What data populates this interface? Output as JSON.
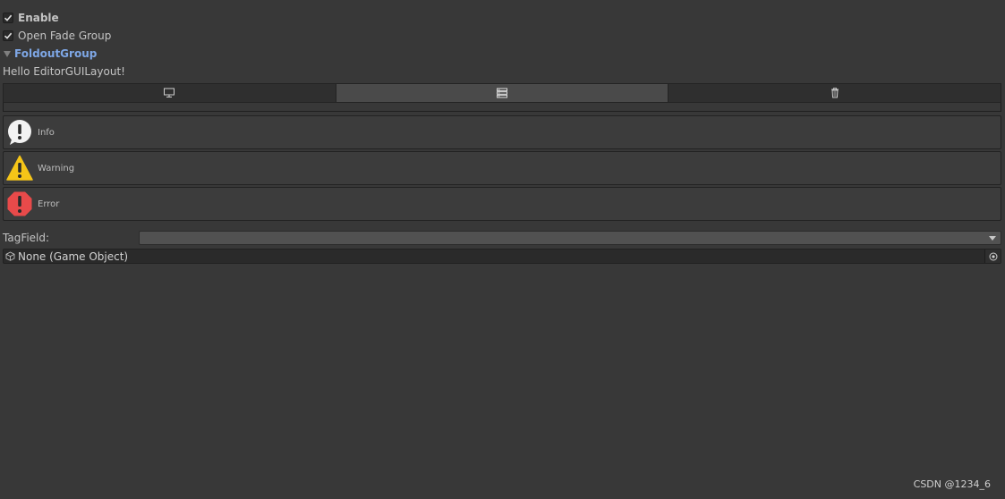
{
  "enable": {
    "label": "Enable",
    "checked": true
  },
  "fade_group": {
    "label": "Open Fade Group",
    "checked": true
  },
  "foldout": {
    "label": "FoldoutGroup",
    "expanded": true
  },
  "hello_label": "Hello EditorGUILayout!",
  "toolbar": {
    "buttons": [
      {
        "icon": "monitor-icon",
        "selected": false
      },
      {
        "icon": "server-icon",
        "selected": true
      },
      {
        "icon": "trash-icon",
        "selected": false
      }
    ]
  },
  "help_boxes": [
    {
      "type": "info",
      "text": "Info",
      "icon": "info-icon"
    },
    {
      "type": "warning",
      "text": "Warning",
      "icon": "warning-icon"
    },
    {
      "type": "error",
      "text": "Error",
      "icon": "error-icon"
    }
  ],
  "tag_field": {
    "label": "TagField:",
    "value": ""
  },
  "object_field": {
    "value": "None (Game Object)"
  },
  "watermark": "CSDN @1234_6",
  "colors": {
    "background": "#383838",
    "foldout_accent": "#7ea7e6",
    "warning": "#f5c518",
    "error": "#e84a4a"
  }
}
